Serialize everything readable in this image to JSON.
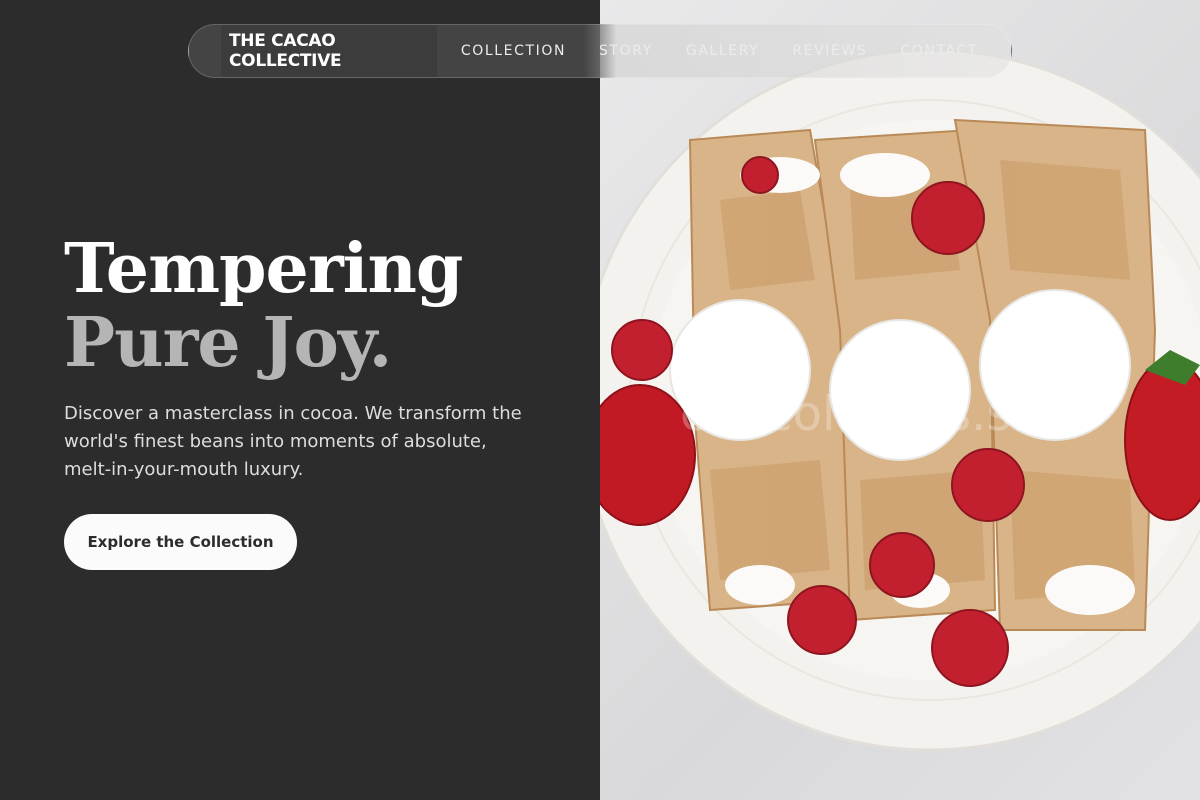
{
  "nav": {
    "brand": "THE CACAO COLLECTIVE",
    "links": [
      "COLLECTION",
      "STORY",
      "GALLERY",
      "REVIEWS",
      "CONTACT"
    ]
  },
  "hero": {
    "headline_line1": "Tempering",
    "headline_line2": "Pure Joy.",
    "description": "Discover a masterclass in cocoa. We transform the world's finest beans into moments of absolute, melt-in-your-mouth luxury.",
    "cta_label": "Explore the Collection"
  },
  "image": {
    "watermark": "chocolatiers.site"
  },
  "colors": {
    "left_background": "#2c2c2c",
    "headline_primary": "#ffffff",
    "headline_secondary": "#b5b5b5",
    "button_background": "#fbfbfb"
  }
}
